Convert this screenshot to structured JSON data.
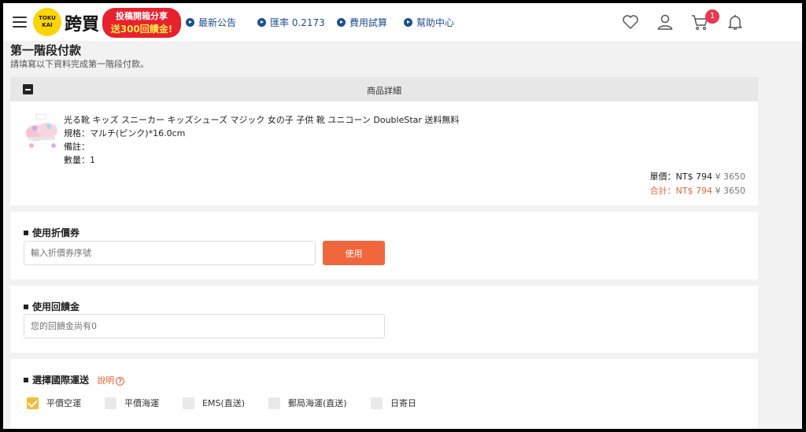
{
  "header": {
    "logo_badge_top": "TOKU",
    "logo_badge_bottom": "KAI",
    "logo_text": "跨買",
    "promo_line1": "投稿開箱分享",
    "promo_line2": "送300回饋金!",
    "nav": [
      {
        "label": "最新公告",
        "icon": "play-circle-icon"
      },
      {
        "label": "匯率 0.2173",
        "icon": "play-circle-icon"
      },
      {
        "label": "費用試算",
        "icon": "play-circle-icon"
      },
      {
        "label": "幫助中心",
        "icon": "play-circle-icon"
      }
    ],
    "cart_count": "1"
  },
  "page": {
    "title": "第一階段付款",
    "subtitle": "請填寫以下資料完成第一階段付款。"
  },
  "product_detail": {
    "header": "商品詳細",
    "name": "光る靴 キッズ スニーカー キッズシューズ マジック 女の子 子供 靴 ユニコーン DoubleStar 送料無料",
    "spec": "規格：マルチ(ピンク)*16.0cm",
    "note": "備註：",
    "qty": "數量：1",
    "unit_label": "單價：",
    "unit_ntd": "NT$ 794",
    "unit_jpy": "¥ 3650",
    "total_label": "合計：",
    "total_ntd": "NT$ 794",
    "total_jpy": "¥ 3650"
  },
  "coupon": {
    "title": "使用折價券",
    "placeholder": "輸入折價券序號",
    "button": "使用"
  },
  "rebate": {
    "title": "使用回饋金",
    "placeholder": "您的回饋金尚有0"
  },
  "shipping": {
    "title": "選擇國際運送",
    "help": "說明",
    "help_icon": "question-circle-icon",
    "options": [
      {
        "label": "平價空運",
        "checked": true
      },
      {
        "label": "平價海運",
        "checked": false
      },
      {
        "label": "EMS(直送)",
        "checked": false
      },
      {
        "label": "郵局海運(直送)",
        "checked": false
      },
      {
        "label": "日寄日",
        "checked": false
      }
    ]
  },
  "colors": {
    "accent": "#f0673d",
    "nav_blue": "#1d4f8c",
    "promo_red": "#e8212f",
    "checked": "#f5b93a"
  }
}
